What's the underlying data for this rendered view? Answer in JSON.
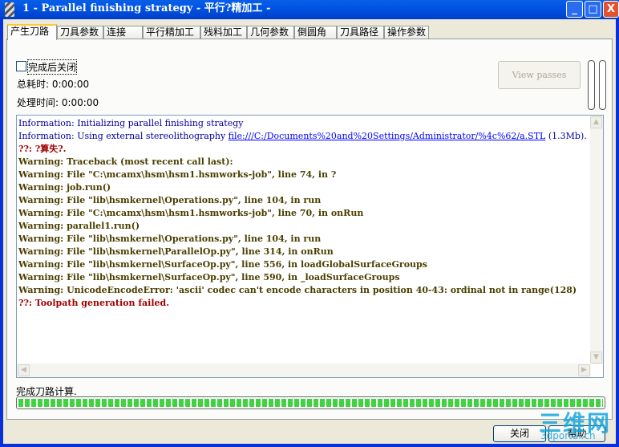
{
  "window": {
    "title": "1 - Parallel finishing strategy - 平行?精加工 -",
    "minimize": "_",
    "maximize": "□",
    "close": "X"
  },
  "tabs": [
    "产生刀路",
    "刀具参数",
    "连接",
    "平行精加工",
    "残料加工",
    "几何参数",
    "倒圆角",
    "刀具路径",
    "操作参数"
  ],
  "active_tab": 0,
  "close_on_finish": {
    "label": "完成后关闭",
    "checked": false
  },
  "total_time": "总耗时: 0:00:00",
  "process_time": "处理时间: 0:00:00",
  "view_passes": "View passes",
  "log": [
    {
      "type": "info",
      "text": "Information: Initializing parallel finishing strategy"
    },
    {
      "type": "info",
      "text": "Information: Using external stereolithography ",
      "link": "file:///C:/Documents%20and%20Settings/Administrator/%4c%62/a.STL",
      "suffix": " (1.3Mb)."
    },
    {
      "type": "err",
      "text": "??: ?算失?."
    },
    {
      "type": "warn",
      "text": "Warning: Traceback (most recent call last):"
    },
    {
      "type": "warn",
      "text": "Warning: File \"C:\\mcamx\\hsm\\hsm1.hsmworks-job\", line 74, in ?"
    },
    {
      "type": "warn",
      "text": "Warning: job.run()"
    },
    {
      "type": "warn",
      "text": "Warning: File \"lib\\hsmkernel\\Operations.py\", line 104, in run"
    },
    {
      "type": "warn",
      "text": "Warning: File \"C:\\mcamx\\hsm\\hsm1.hsmworks-job\", line 70, in onRun"
    },
    {
      "type": "warn",
      "text": "Warning: parallel1.run()"
    },
    {
      "type": "warn",
      "text": "Warning: File \"lib\\hsmkernel\\Operations.py\", line 104, in run"
    },
    {
      "type": "warn",
      "text": "Warning: File \"lib\\hsmkernel\\ParallelOp.py\", line 314, in onRun"
    },
    {
      "type": "warn",
      "text": "Warning: File \"lib\\hsmkernel\\SurfaceOp.py\", line 556, in loadGlobalSurfaceGroups"
    },
    {
      "type": "warn",
      "text": "Warning: File \"lib\\hsmkernel\\SurfaceOp.py\", line 590, in _loadSurfaceGroups"
    },
    {
      "type": "warn",
      "text": "Warning: UnicodeEncodeError: 'ascii' codec can't encode characters in position 40-43: ordinal not in range(128)"
    },
    {
      "type": "err",
      "text": "??: Toolpath generation failed."
    }
  ],
  "status": "完成刀路计算.",
  "progress_percent": 100,
  "buttons": {
    "close": "关闭",
    "help": "帮助"
  },
  "watermark": {
    "main": "三维网",
    "sub": "3dportal.cn"
  },
  "colors": {
    "info": "#0000a0",
    "warning": "#4a3f00",
    "error": "#a00000",
    "progress": "#3fd33f",
    "titlebar": "#0054e3"
  }
}
